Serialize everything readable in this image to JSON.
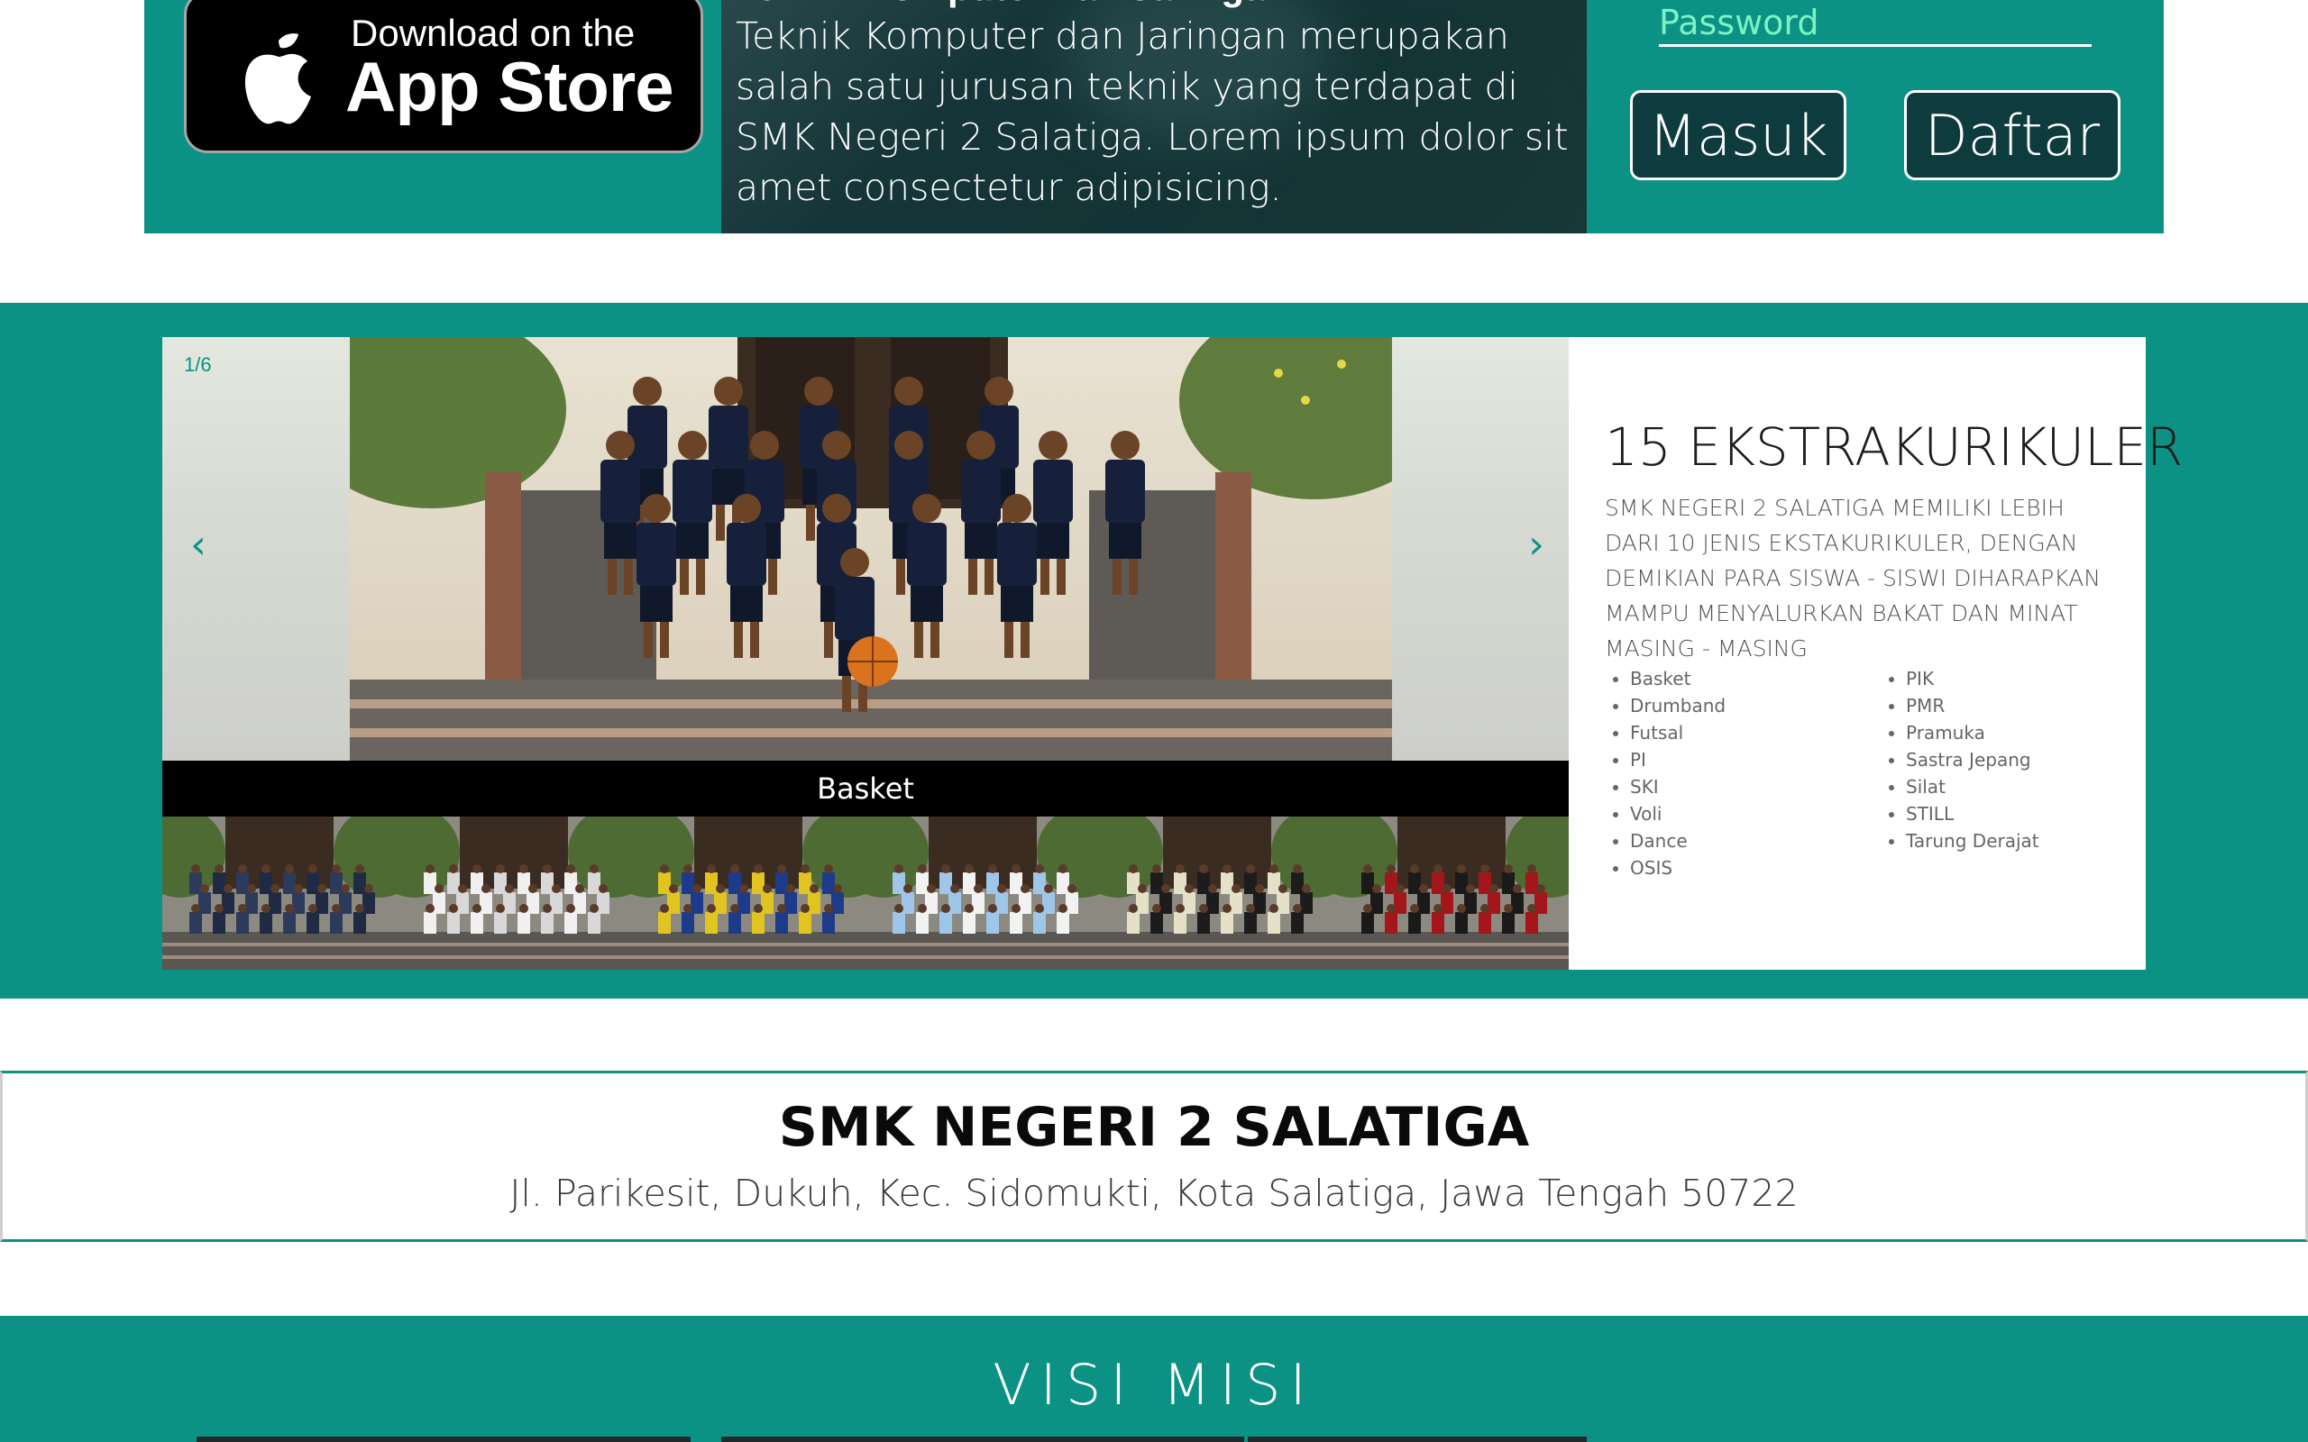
{
  "top": {
    "appstore": {
      "small_text": "Download on the",
      "big_text": "App Store"
    },
    "photo_heading": "Teknik Komputer dan Jaringan",
    "photo_text": "Teknik Komputer dan Jaringan merupakan salah satu jurusan teknik yang terdapat di SMK Negeri 2 Salatiga. Lorem ipsum dolor sit amet consectetur adipisicing.",
    "password_placeholder": "Password",
    "login_label": "Masuk",
    "register_label": "Daftar"
  },
  "slider": {
    "counter": "1/6",
    "prev": "‹",
    "next": "›",
    "caption": "Basket",
    "thumbs": [
      "basket",
      "drumband",
      "futsal",
      "pramuka",
      "paskibra",
      "silat"
    ]
  },
  "extra": {
    "title": "15 EKSTRAKURIKULER",
    "description": "SMK NEGERI 2 SALATIGA MEMILIKI LEBIH DARI 10 JENIS EKSTAKURIKULER, DENGAN DEMIKIAN PARA SISWA - SISWI DIHARAPKAN MAMPU MENYALURKAN BAKAT DAN MINAT MASING - MASING",
    "list_left": [
      "Basket",
      "Drumband",
      "Futsal",
      "PI",
      "SKI",
      "Voli",
      "Dance",
      "OSIS"
    ],
    "list_right": [
      "PIK",
      "PMR",
      "Pramuka",
      "Sastra Jepang",
      "Silat",
      "STILL",
      "Tarung Derajat"
    ]
  },
  "school": {
    "name": "SMK NEGERI 2 SALATIGA",
    "address": "Jl. Parikesit, Dukuh, Kec. Sidomukti, Kota Salatiga, Jawa Tengah 50722"
  },
  "visi": {
    "title": "VISI MISI"
  },
  "colors": {
    "teal": "#0b9284",
    "password_text": "#7cf2c4"
  }
}
